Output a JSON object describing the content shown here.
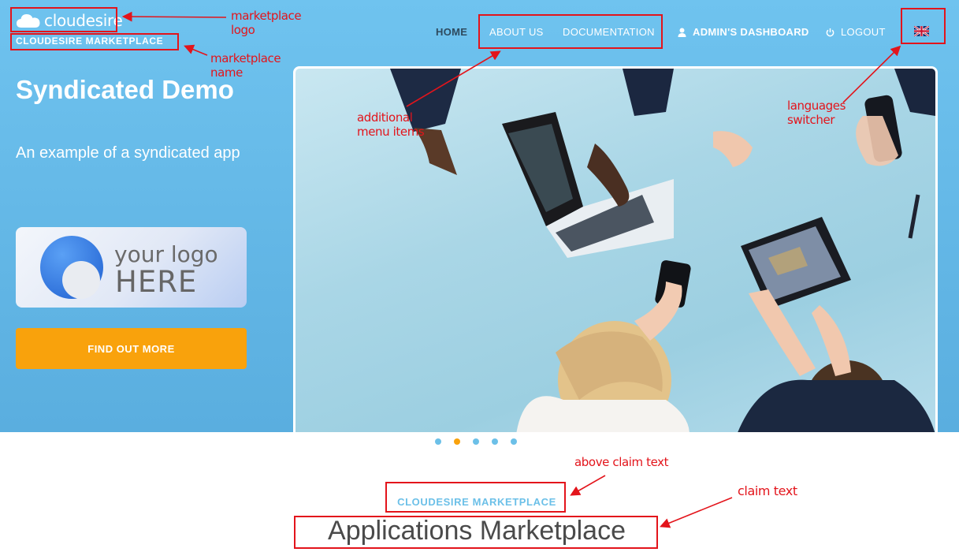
{
  "header": {
    "logo_text": "cloudesire",
    "marketplace_name": "CLOUDESIRE MARKETPLACE",
    "nav": {
      "home": "HOME",
      "about": "ABOUT US",
      "documentation": "DOCUMENTATION",
      "admin": "ADMIN'S DASHBOARD",
      "logout": "LOGOUT"
    },
    "language_flag": "uk-flag-icon"
  },
  "hero": {
    "title": "Syndicated Demo",
    "subtitle": "An example of a syndicated app",
    "logo_line1": "your logo",
    "logo_line2": "HERE",
    "cta_label": "FIND OUT MORE"
  },
  "carousel": {
    "slide_count": 5,
    "active_index": 1
  },
  "claim": {
    "above_text": "CLOUDESIRE MARKETPLACE",
    "text": "Applications Marketplace"
  },
  "annotations": {
    "logo": "marketplace\nlogo",
    "name": "marketplace\nname",
    "menu": "additional\nmenu items",
    "lang": "languages\nswitcher",
    "above_claim": "above claim text",
    "claim": "claim text"
  },
  "colors": {
    "hero_blue": "#6fc3ef",
    "accent_orange": "#f9a20c",
    "annotation_red": "#e3141b"
  }
}
